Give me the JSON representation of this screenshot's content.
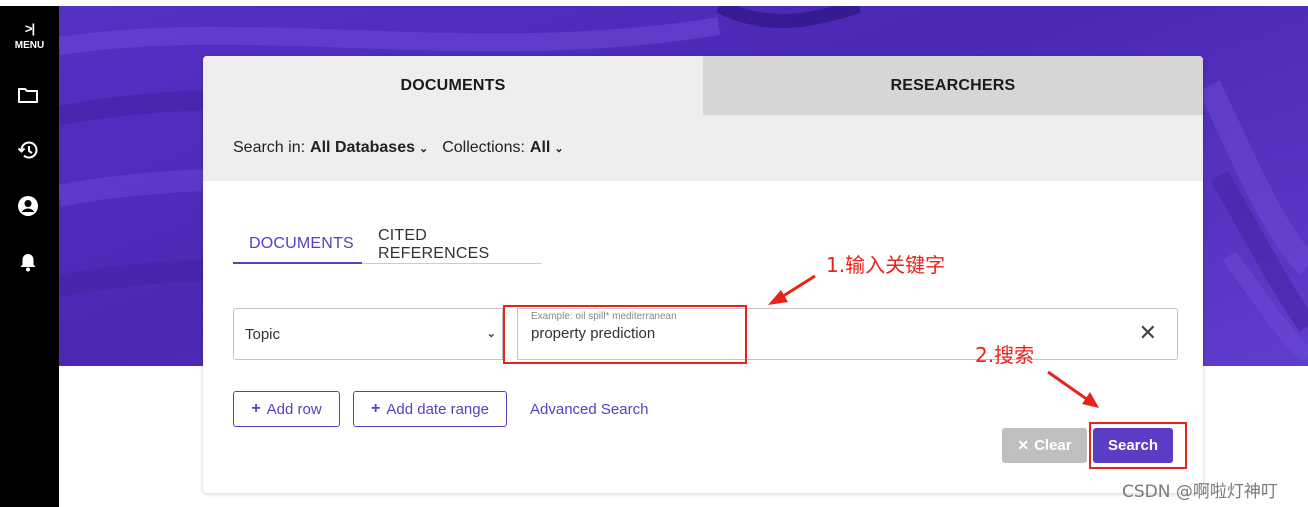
{
  "sidebar": {
    "toggle_glyph": ">|",
    "menu_label": "MENU",
    "icons": [
      "folder-icon",
      "history-icon",
      "account-icon",
      "bell-icon"
    ]
  },
  "tabs": {
    "documents": "DOCUMENTS",
    "researchers": "RESEARCHERS"
  },
  "filters": {
    "search_in_label": "Search in:",
    "search_in_value": "All Databases",
    "collections_label": "Collections:",
    "collections_value": "All"
  },
  "sub_tabs": {
    "documents": "DOCUMENTS",
    "cited_references": "CITED REFERENCES"
  },
  "search_row": {
    "field": "Topic",
    "placeholder": "Example: oil spill* mediterranean",
    "query": "property prediction"
  },
  "actions": {
    "add_row": "Add row",
    "add_date_range": "Add date range",
    "advanced_search": "Advanced Search",
    "clear": "Clear",
    "search": "Search"
  },
  "annotations": {
    "step1": "1.输入关键字",
    "step2": "2.搜索"
  },
  "watermark": "CSDN @啊啦灯神叮",
  "colors": {
    "accent": "#5b3cc4",
    "hero": "#5430c4",
    "annotation": "#e8231b"
  }
}
